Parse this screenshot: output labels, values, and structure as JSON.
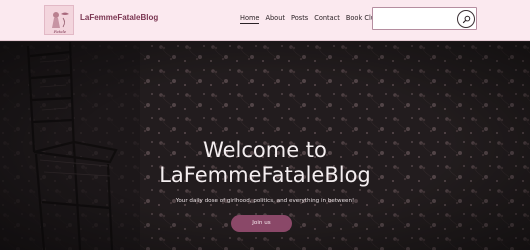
{
  "header": {
    "site_title": "LaFemmeFataleBlog",
    "logo_text": "Fatale"
  },
  "nav": {
    "items": [
      {
        "label": "Home",
        "active": true
      },
      {
        "label": "About",
        "active": false
      },
      {
        "label": "Posts",
        "active": false
      },
      {
        "label": "Contact",
        "active": false
      },
      {
        "label": "Book Club",
        "active": false
      }
    ]
  },
  "search": {
    "value": "",
    "placeholder": "",
    "icon": "search-icon"
  },
  "hero": {
    "title_line1": "Welcome to",
    "title_line2": "LaFemmeFataleBlog",
    "subtitle": "Your daily dose of girlhood, politics, and everything in between!",
    "cta_label": "Join us"
  },
  "colors": {
    "header_bg": "#fbe9ef",
    "brand": "#7a3551",
    "cta_bg": "#8a4868",
    "hero_dark": "#231e20"
  }
}
